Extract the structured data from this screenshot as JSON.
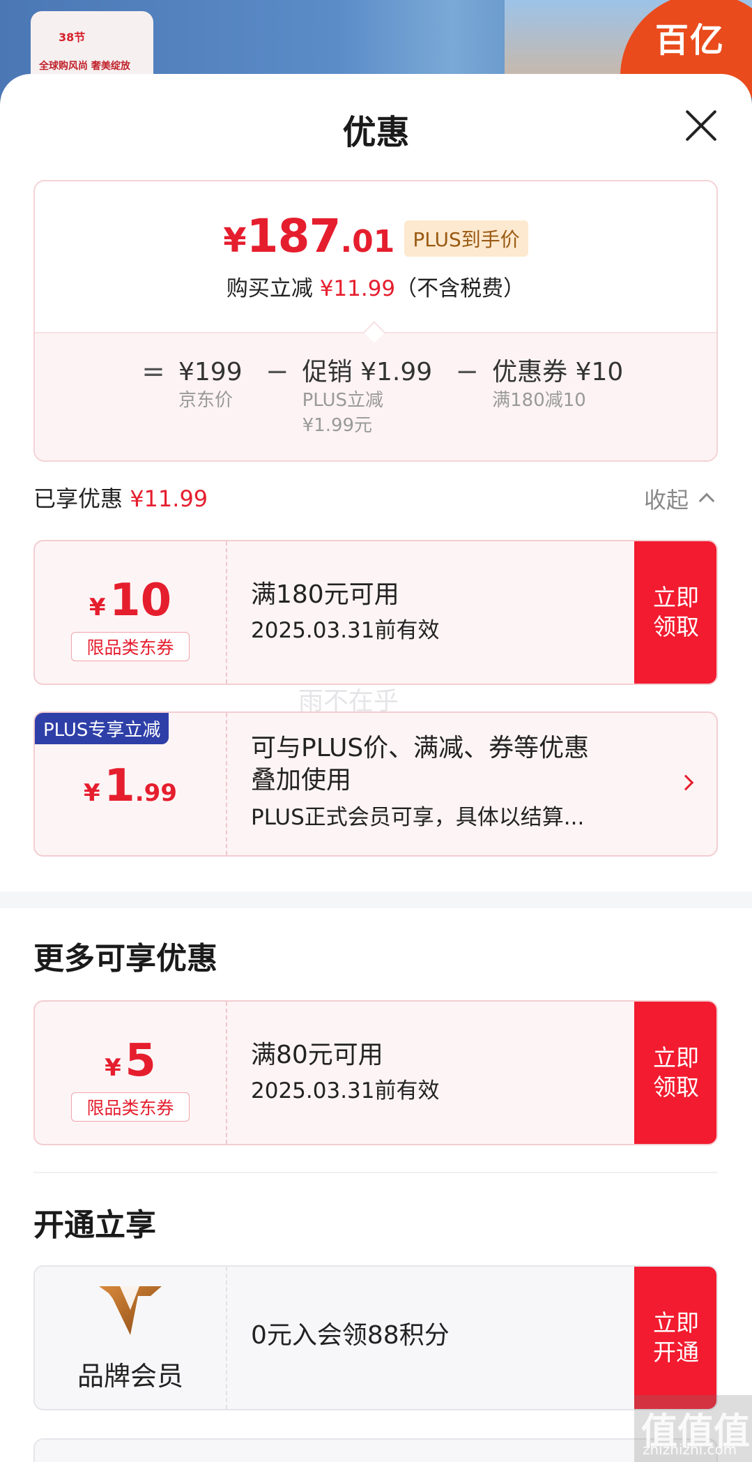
{
  "background": {
    "badge": "38节",
    "caption": "全球购风尚 奢美绽放",
    "promo": "百亿"
  },
  "sheet": {
    "title": "优惠"
  },
  "price_box": {
    "yen": "¥",
    "price_int": "187",
    "price_dec": ".01",
    "plus_tag": "PLUS到手价",
    "save_prefix": "购买立减",
    "save_amount": "¥11.99",
    "save_suffix": "（不含税费）",
    "calc": [
      {
        "op": "=",
        "value": "¥199",
        "sub": "京东价"
      },
      {
        "op": "−",
        "value": "促销 ¥1.99",
        "sub": "PLUS立减",
        "sub2": "¥1.99元"
      },
      {
        "op": "−",
        "value": "优惠券 ¥10",
        "sub": "满180减10"
      }
    ]
  },
  "enjoyed": {
    "label": "已享优惠",
    "amount": "¥11.99",
    "collapse": "收起"
  },
  "coupons": [
    {
      "yen": "¥",
      "amount": "10",
      "tag": "限品类东券",
      "main": "满180元可用",
      "sub": "2025.03.31前有效",
      "btn1": "立即",
      "btn2": "领取"
    }
  ],
  "plus_card": {
    "badge": "PLUS专享立减",
    "yen": "¥",
    "amount": "1",
    "dec": ".99",
    "line1": "可与PLUS价、满减、券等优惠",
    "line2": "叠加使用",
    "line3": "PLUS正式会员可享，具体以结算..."
  },
  "more": {
    "title": "更多可享优惠",
    "coupon": {
      "yen": "¥",
      "amount": "5",
      "tag": "限品类东券",
      "main": "满80元可用",
      "sub": "2025.03.31前有效",
      "btn1": "立即",
      "btn2": "领取"
    }
  },
  "membership": {
    "title": "开通立享",
    "brand_name": "品牌会员",
    "main": "0元入会领88积分",
    "btn1": "立即",
    "btn2": "开通"
  },
  "watermarks": {
    "center": "雨不在乎",
    "corner": "值值值",
    "url": "zhizhizhi.com"
  },
  "colors": {
    "accent": "#e51e2e",
    "button": "#f21b2f",
    "plus_badge": "#2e3fa8",
    "plus_tag_bg": "#fde9cf"
  }
}
